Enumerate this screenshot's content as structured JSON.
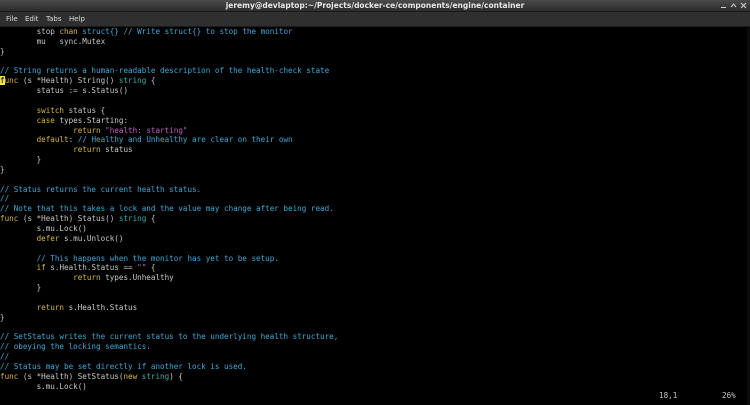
{
  "window": {
    "title": "jeremy@devlaptop:~/Projects/docker-ce/components/engine/container",
    "controls": [
      "minimize-icon",
      "maximize-icon",
      "close-icon"
    ]
  },
  "menu": [
    "File",
    "Edit",
    "Tabs",
    "Help"
  ],
  "code": [
    [
      [
        "        stop ",
        ""
      ],
      [
        "chan",
        "k"
      ],
      [
        " struct{} // Write struct{} to stop the monitor",
        "c"
      ]
    ],
    [
      [
        "        mu   sync.Mutex",
        ""
      ]
    ],
    [
      [
        "}",
        ""
      ]
    ],
    [
      [
        "",
        ""
      ]
    ],
    [
      [
        "// String returns a human-readable description of the health-check state",
        "c"
      ]
    ],
    [
      [
        "f",
        "cursor"
      ],
      [
        "unc",
        "k"
      ],
      [
        " (s *Health) String() ",
        ""
      ],
      [
        "string",
        "ty"
      ],
      [
        " {",
        ""
      ]
    ],
    [
      [
        "        status := s.Status()",
        ""
      ]
    ],
    [
      [
        "",
        ""
      ]
    ],
    [
      [
        "        ",
        ""
      ],
      [
        "switch",
        "k"
      ],
      [
        " status {",
        ""
      ]
    ],
    [
      [
        "        ",
        ""
      ],
      [
        "case",
        "k"
      ],
      [
        " types.Starting:",
        ""
      ]
    ],
    [
      [
        "                ",
        ""
      ],
      [
        "return",
        "k"
      ],
      [
        " ",
        ""
      ],
      [
        "\"health: starting\"",
        "s"
      ]
    ],
    [
      [
        "        ",
        ""
      ],
      [
        "default",
        "k"
      ],
      [
        ": ",
        ""
      ],
      [
        "// Healthy and Unhealthy are clear on their own",
        "c"
      ]
    ],
    [
      [
        "                ",
        ""
      ],
      [
        "return",
        "k"
      ],
      [
        " status",
        ""
      ]
    ],
    [
      [
        "        }",
        ""
      ]
    ],
    [
      [
        "}",
        ""
      ]
    ],
    [
      [
        "",
        ""
      ]
    ],
    [
      [
        "// Status returns the current health status.",
        "c"
      ]
    ],
    [
      [
        "//",
        "c"
      ]
    ],
    [
      [
        "// Note that this takes a lock and the value may change after being read.",
        "c"
      ]
    ],
    [
      [
        "func",
        "k"
      ],
      [
        " (s *Health) Status() ",
        ""
      ],
      [
        "string",
        "ty"
      ],
      [
        " {",
        ""
      ]
    ],
    [
      [
        "        s.mu.Lock()",
        ""
      ]
    ],
    [
      [
        "        ",
        ""
      ],
      [
        "defer",
        "k"
      ],
      [
        " s.mu.Unlock()",
        ""
      ]
    ],
    [
      [
        "",
        ""
      ]
    ],
    [
      [
        "        ",
        ""
      ],
      [
        "// This happens when the monitor has yet to be setup.",
        "c"
      ]
    ],
    [
      [
        "        ",
        ""
      ],
      [
        "if",
        "k"
      ],
      [
        " s.Health.Status == ",
        ""
      ],
      [
        "\"\"",
        "s"
      ],
      [
        " {",
        ""
      ]
    ],
    [
      [
        "                ",
        ""
      ],
      [
        "return",
        "k"
      ],
      [
        " types.Unhealthy",
        ""
      ]
    ],
    [
      [
        "        }",
        ""
      ]
    ],
    [
      [
        "",
        ""
      ]
    ],
    [
      [
        "        ",
        ""
      ],
      [
        "return",
        "k"
      ],
      [
        " s.Health.Status",
        ""
      ]
    ],
    [
      [
        "}",
        ""
      ]
    ],
    [
      [
        "",
        ""
      ]
    ],
    [
      [
        "// SetStatus writes the current status to the underlying health structure,",
        "c"
      ]
    ],
    [
      [
        "// obeying the locking semantics.",
        "c"
      ]
    ],
    [
      [
        "//",
        "c"
      ]
    ],
    [
      [
        "// Status may be set directly if another lock is used.",
        "c"
      ]
    ],
    [
      [
        "func",
        "k"
      ],
      [
        " (s *Health) SetStatus(",
        ""
      ],
      [
        "new",
        "k"
      ],
      [
        " ",
        ""
      ],
      [
        "string",
        "ty"
      ],
      [
        ") {",
        ""
      ]
    ],
    [
      [
        "        s.mu.Lock()",
        ""
      ]
    ]
  ],
  "status": {
    "position": "18,1",
    "percent": "26%"
  }
}
